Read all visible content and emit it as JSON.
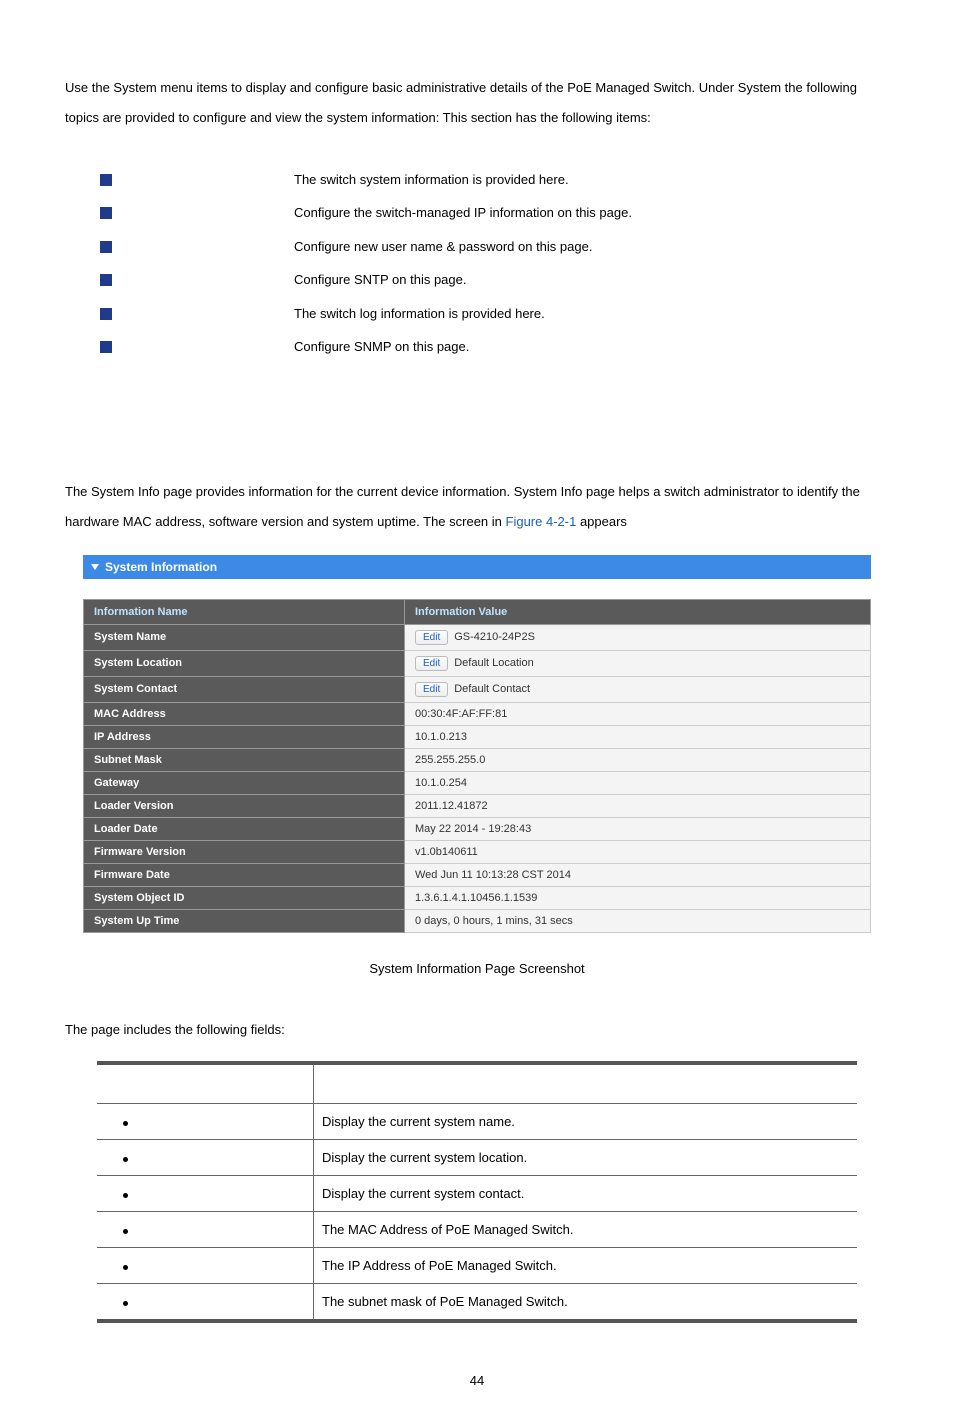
{
  "intro_text": "Use the System menu items to display and configure basic administrative details of the PoE Managed Switch. Under System the following topics are provided to configure and view the system information: This section has the following items:",
  "menu_items": [
    "The switch system information is provided here.",
    "Configure the switch-managed IP information on this page.",
    "Configure new user name & password on this page.",
    "Configure SNTP on this page.",
    "The switch log information is provided here.",
    "Configure SNMP on this page."
  ],
  "sysinfo_intro_1": "The System Info page provides information for the current device information. System Info page helps a switch administrator to identify the hardware MAC address, software version and system uptime. The screen in ",
  "sysinfo_link": "Figure 4-2-1",
  "sysinfo_intro_2": " appears",
  "panel_title": "System Information",
  "info_table": {
    "head_name": "Information Name",
    "head_value": "Information Value",
    "rows": [
      {
        "k": "System Name",
        "edit": true,
        "v": "GS-4210-24P2S"
      },
      {
        "k": "System Location",
        "edit": true,
        "v": "Default Location"
      },
      {
        "k": "System Contact",
        "edit": true,
        "v": "Default Contact"
      },
      {
        "k": "MAC Address",
        "edit": false,
        "v": "00:30:4F:AF:FF:81"
      },
      {
        "k": "IP Address",
        "edit": false,
        "v": "10.1.0.213"
      },
      {
        "k": "Subnet Mask",
        "edit": false,
        "v": "255.255.255.0"
      },
      {
        "k": "Gateway",
        "edit": false,
        "v": "10.1.0.254"
      },
      {
        "k": "Loader Version",
        "edit": false,
        "v": "2011.12.41872"
      },
      {
        "k": "Loader Date",
        "edit": false,
        "v": "May 22 2014 - 19:28:43"
      },
      {
        "k": "Firmware Version",
        "edit": false,
        "v": "v1.0b140611"
      },
      {
        "k": "Firmware Date",
        "edit": false,
        "v": "Wed Jun 11 10:13:28 CST 2014"
      },
      {
        "k": "System Object ID",
        "edit": false,
        "v": "1.3.6.1.4.1.10456.1.1539"
      },
      {
        "k": "System Up Time",
        "edit": false,
        "v": "0 days, 0 hours, 1 mins, 31 secs"
      }
    ],
    "edit_label": "Edit"
  },
  "caption": "System Information Page Screenshot",
  "fields_intro": "The page includes the following fields:",
  "field_rows": [
    "Display the current system name.",
    "Display the current system location.",
    "Display the current system contact.",
    "The MAC Address of PoE Managed Switch.",
    "The IP Address of PoE Managed Switch.",
    "The subnet mask of PoE Managed Switch."
  ],
  "page_number": "44"
}
